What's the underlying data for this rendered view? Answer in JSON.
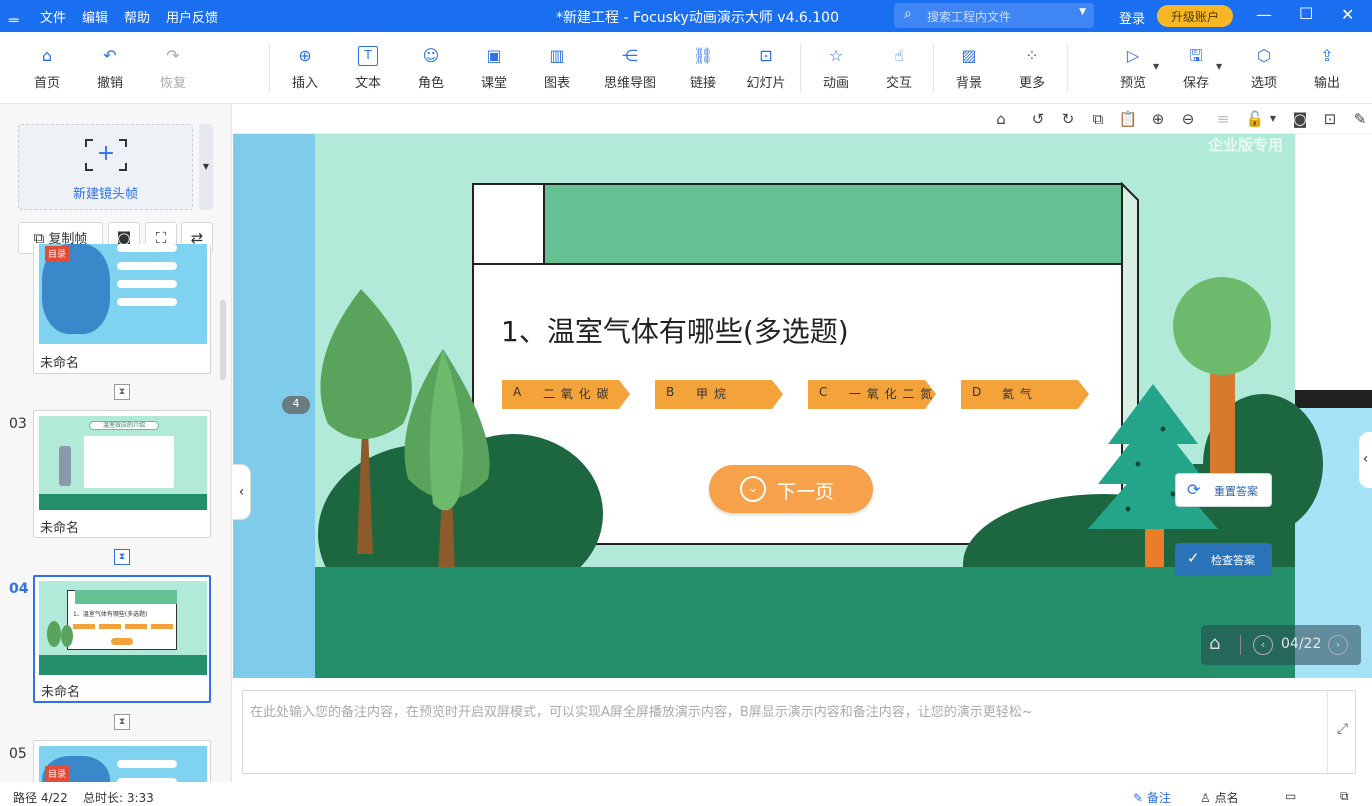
{
  "titlebar": {
    "logo_icon": "fold-icon",
    "menu": [
      "文件",
      "编辑",
      "帮助",
      "用户反馈"
    ],
    "title": "*新建工程 - Focusky动画演示大师  v4.6.100",
    "search_placeholder": "搜索工程内文件",
    "login": "登录",
    "upgrade": "升级账户"
  },
  "toolbar": {
    "items": [
      {
        "label": "首页",
        "icon": "home-icon"
      },
      {
        "label": "撤销",
        "icon": "undo-icon"
      },
      {
        "label": "恢复",
        "icon": "redo-icon"
      },
      {
        "label": "插入",
        "icon": "plus-circle-icon"
      },
      {
        "label": "文本",
        "icon": "text-icon"
      },
      {
        "label": "角色",
        "icon": "character-icon"
      },
      {
        "label": "课堂",
        "icon": "classroom-icon"
      },
      {
        "label": "图表",
        "icon": "bar-chart-icon"
      },
      {
        "label": "思维导图",
        "icon": "mindmap-icon"
      },
      {
        "label": "链接",
        "icon": "link-icon"
      },
      {
        "label": "幻灯片",
        "icon": "slides-icon"
      },
      {
        "label": "动画",
        "icon": "star-icon"
      },
      {
        "label": "交互",
        "icon": "hand-icon"
      },
      {
        "label": "背景",
        "icon": "background-icon"
      },
      {
        "label": "更多",
        "icon": "more-icon"
      },
      {
        "label": "预览",
        "icon": "play-icon"
      },
      {
        "label": "保存",
        "icon": "save-icon"
      },
      {
        "label": "选项",
        "icon": "options-icon"
      },
      {
        "label": "输出",
        "icon": "export-icon"
      }
    ]
  },
  "left": {
    "new_frame_label": "新建镜头帧",
    "copy_frame_label": "复制帧",
    "slides": [
      {
        "num": "",
        "name": "未命名",
        "thumb_text": "目录"
      },
      {
        "num": "03",
        "name": "未命名",
        "thumb_text": "温室效应的介绍"
      },
      {
        "num": "04",
        "name": "未命名",
        "thumb_text": "1、温室气体有哪些(多选题)"
      },
      {
        "num": "05",
        "name": "",
        "thumb_text": "目录"
      }
    ]
  },
  "stage": {
    "watermark": "企业版专用",
    "frame_badge": "4",
    "question": "1、温室气体有哪些(多选题)",
    "options": [
      {
        "letter": "A",
        "text": "二 氧 化 碳"
      },
      {
        "letter": "B",
        "text": "甲 烷"
      },
      {
        "letter": "C",
        "text": "一 氧 化 二 氮"
      },
      {
        "letter": "D",
        "text": "氦 气"
      }
    ],
    "next_label": "下一页",
    "reset_label": "重置答案",
    "check_label": "检查答案",
    "page_indicator": "04/22",
    "colors": {
      "sky": "#b1ead9",
      "panel_header": "#66c194",
      "option": "#f4a33b",
      "ground": "#24906b",
      "side_blue": "#7ecbea"
    }
  },
  "notes": {
    "placeholder": "在此处输入您的备注内容，在预览时开启双屏模式，可以实现A屏全屏播放演示内容，B屏显示演示内容和备注内容，让您的演示更轻松~"
  },
  "status": {
    "path": "路径 4/22",
    "duration": "总时长: 3:33",
    "notes_label": "备注",
    "rollcall_label": "点名"
  }
}
